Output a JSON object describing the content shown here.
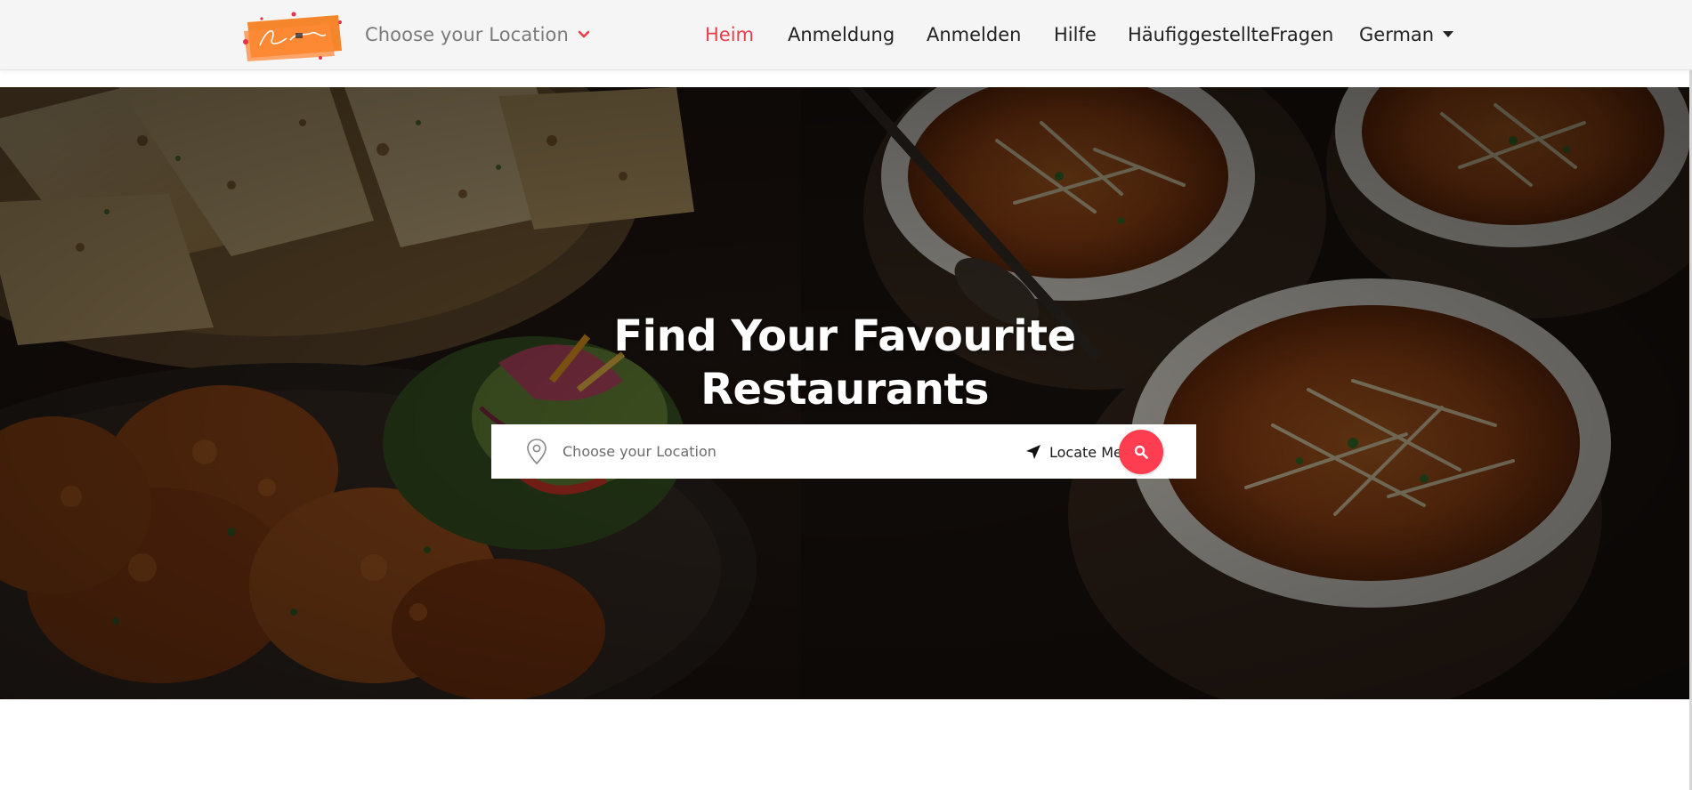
{
  "header": {
    "logo_label": "Brand logo",
    "location_label": "Choose your Location",
    "nav": [
      {
        "label": "Heim",
        "active": true
      },
      {
        "label": "Anmeldung",
        "active": false
      },
      {
        "label": "Anmelden",
        "active": false
      },
      {
        "label": "Hilfe",
        "active": false
      },
      {
        "label": "HäufiggestellteFragen",
        "active": false
      },
      {
        "label": "German",
        "active": false,
        "has_caret": true
      }
    ]
  },
  "hero": {
    "title_line1": "Find Your Favourite",
    "title_line2": "Restaurants",
    "search": {
      "placeholder": "Choose your Location",
      "value": "",
      "locate_label": "Locate Me"
    }
  },
  "colors": {
    "accent": "#ea3e4c",
    "search_button": "#ff3d50",
    "header_bg": "#f5f5f5",
    "logo_orange": "#f5862b"
  },
  "icons": {
    "location_chevron": "chevron-down-icon",
    "search_pin": "map-pin-icon",
    "locate": "navigation-arrow-icon",
    "search": "search-icon",
    "language_caret": "caret-down-icon"
  }
}
